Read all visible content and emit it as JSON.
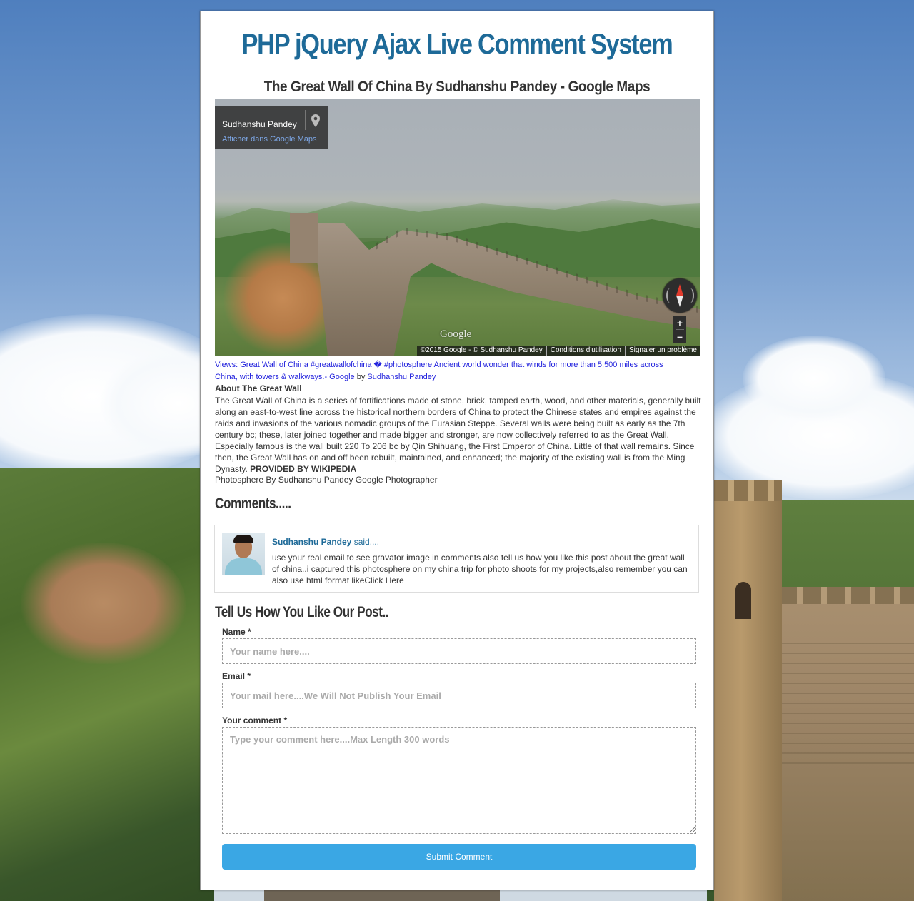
{
  "page": {
    "site_title": "PHP jQuery Ajax Live Comment System",
    "post_title": "The Great Wall Of China By Sudhanshu Pandey - Google Maps"
  },
  "map": {
    "infobox_name": "Sudhanshu Pandey",
    "infobox_link": "Afficher dans Google Maps",
    "logo": "Google",
    "zoom_in": "+",
    "zoom_out": "–",
    "footer": [
      "©2015 Google - © Sudhanshu Pandey",
      "Conditions d'utilisation",
      "Signaler un problème"
    ]
  },
  "caption": {
    "link_text": "Views: Great Wall of China #greatwallofchina � #photosphere Ancient world wonder that winds for more than 5,500 miles across China, with towers & walkways.- Google",
    "by": "by",
    "author_link": "Sudhanshu Pandey"
  },
  "about": {
    "title": "About The Great Wall",
    "body": "The Great Wall of China is a series of fortifications made of stone, brick, tamped earth, wood, and other materials, generally built along an east-to-west line across the historical northern borders of China to protect the Chinese states and empires against the raids and invasions of the various nomadic groups of the Eurasian Steppe. Several walls were being built as early as the 7th century bc; these, later joined together and made bigger and stronger, are now collectively referred to as the Great Wall. Especially famous is the wall built 220 To 206 bc by Qin Shihuang, the First Emperor of China. Little of that wall remains. Since then, the Great Wall has on and off been rebuilt, maintained, and enhanced; the majority of the existing wall is from the Ming Dynasty.",
    "source": "PROVIDED BY WIKIPEDIA",
    "credit": "Photosphere By Sudhanshu Pandey Google Photographer"
  },
  "comments": {
    "heading": "Comments.....",
    "items": [
      {
        "author": "Sudhanshu Pandey",
        "said": "said....",
        "text": "use your real email to see gravator image in comments also tell us how you like this post about the great wall of china..i captured this photosphere on my china trip for photo shoots for my projects,also remember you can also use html format likeClick Here"
      }
    ]
  },
  "form": {
    "heading": "Tell Us How You Like Our Post..",
    "name_label": "Name *",
    "name_placeholder": "Your name here....",
    "email_label": "Email *",
    "email_placeholder": "Your mail here....We Will Not Publish Your Email",
    "comment_label": "Your comment *",
    "comment_placeholder": "Type your comment here....Max Length 300 words",
    "submit_label": "Submit Comment"
  },
  "colors": {
    "title_blue": "#1e6a98",
    "button_blue": "#3aa7e4",
    "link_blue": "#2222dd"
  }
}
